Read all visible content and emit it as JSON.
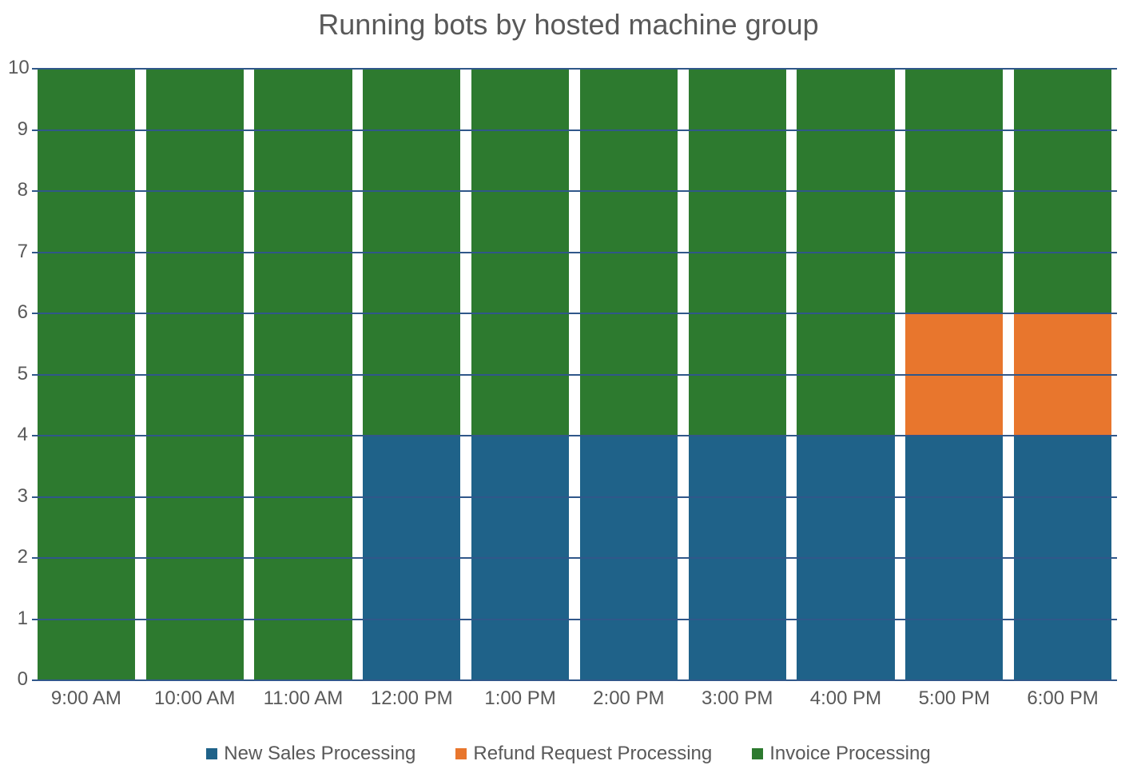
{
  "chart_data": {
    "type": "bar",
    "stacked": true,
    "title": "Running bots by hosted machine group",
    "categories": [
      "9:00 AM",
      "10:00 AM",
      "11:00 AM",
      "12:00 PM",
      "1:00 PM",
      "2:00 PM",
      "3:00 PM",
      "4:00 PM",
      "5:00 PM",
      "6:00 PM"
    ],
    "series": [
      {
        "name": "New Sales Processing",
        "color": "#1f6289",
        "values": [
          0,
          0,
          0,
          4,
          4,
          4,
          4,
          4,
          4,
          4
        ]
      },
      {
        "name": "Refund Request Processing",
        "color": "#e8762d",
        "values": [
          0,
          0,
          0,
          0,
          0,
          0,
          0,
          0,
          2,
          2
        ]
      },
      {
        "name": "Invoice Processing",
        "color": "#2d7a2f",
        "values": [
          10,
          10,
          10,
          6,
          6,
          6,
          6,
          6,
          4,
          4
        ]
      }
    ],
    "ylabel": "",
    "xlabel": "",
    "ylim": [
      0,
      10
    ],
    "y_ticks": [
      0,
      1,
      2,
      3,
      4,
      5,
      6,
      7,
      8,
      9,
      10
    ],
    "grid": true,
    "legend_position": "bottom"
  }
}
